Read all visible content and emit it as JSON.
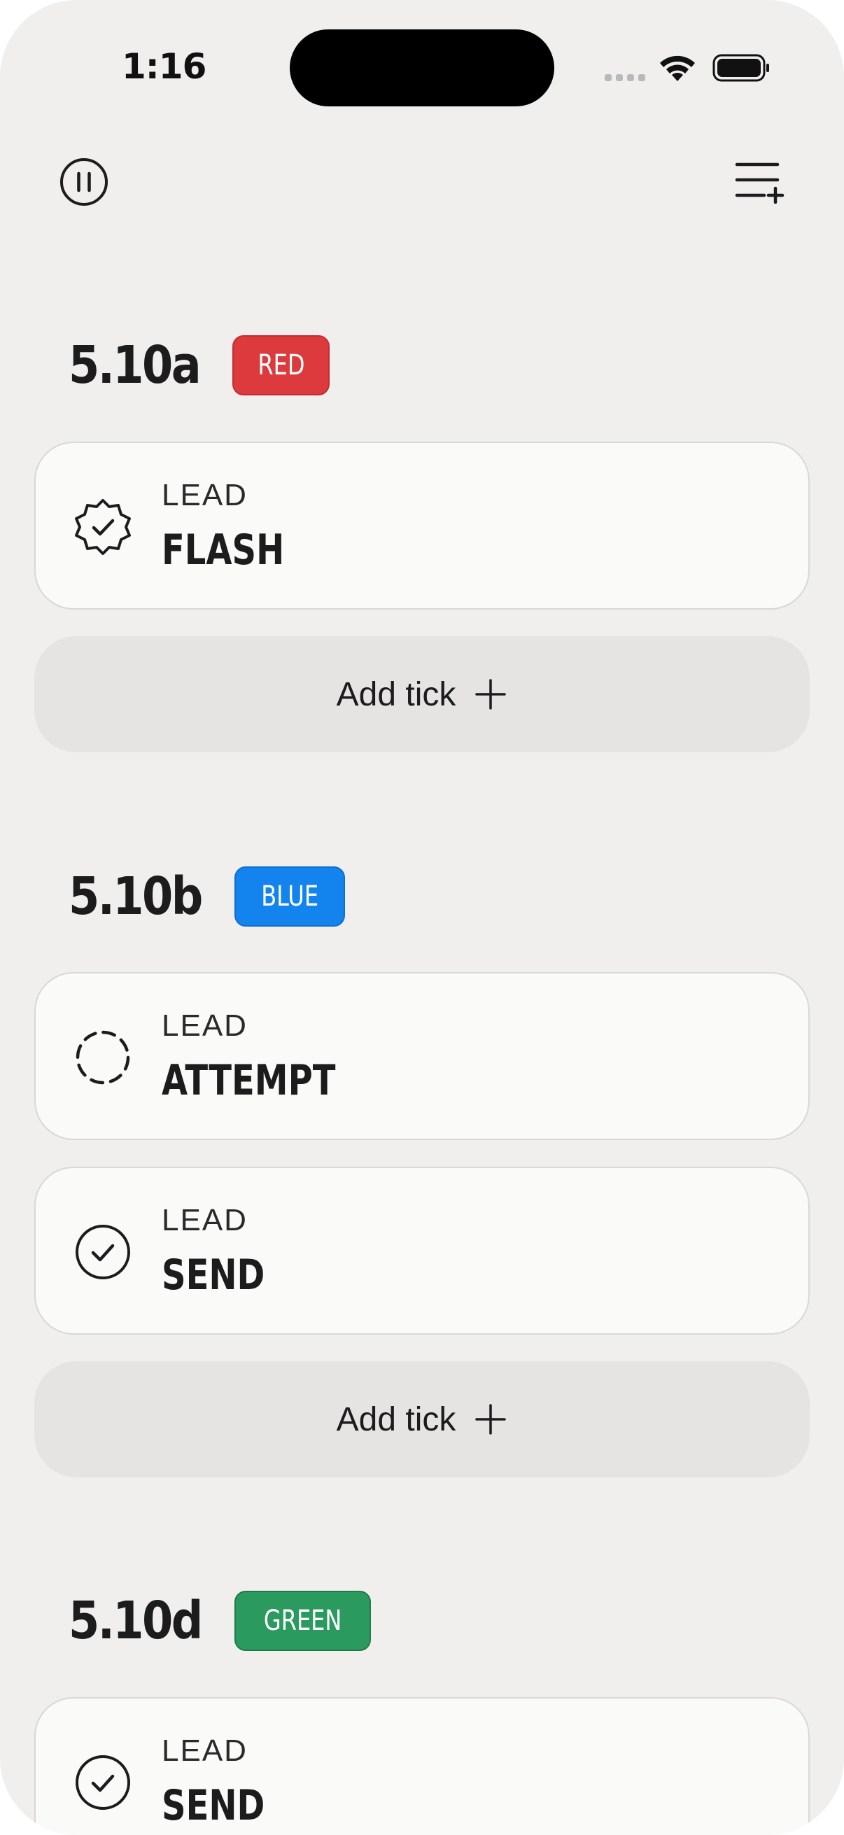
{
  "status_bar": {
    "time": "1:16"
  },
  "toolbar": {
    "pause_icon": "pause-circle-icon",
    "add_list_icon": "list-add-icon"
  },
  "routes": [
    {
      "grade": "5.10a",
      "color_label": "RED",
      "color": "#dc3a3d",
      "ticks": [
        {
          "style": "LEAD",
          "result": "FLASH",
          "icon": "badge-check-icon"
        }
      ],
      "add_tick_label": "Add tick"
    },
    {
      "grade": "5.10b",
      "color_label": "BLUE",
      "color": "#1384ee",
      "ticks": [
        {
          "style": "LEAD",
          "result": "ATTEMPT",
          "icon": "dashed-circle-icon"
        },
        {
          "style": "LEAD",
          "result": "SEND",
          "icon": "check-circle-icon"
        }
      ],
      "add_tick_label": "Add tick"
    },
    {
      "grade": "5.10d",
      "color_label": "GREEN",
      "color": "#2a9a5e",
      "ticks": [
        {
          "style": "LEAD",
          "result": "SEND",
          "icon": "check-circle-icon"
        }
      ]
    }
  ]
}
